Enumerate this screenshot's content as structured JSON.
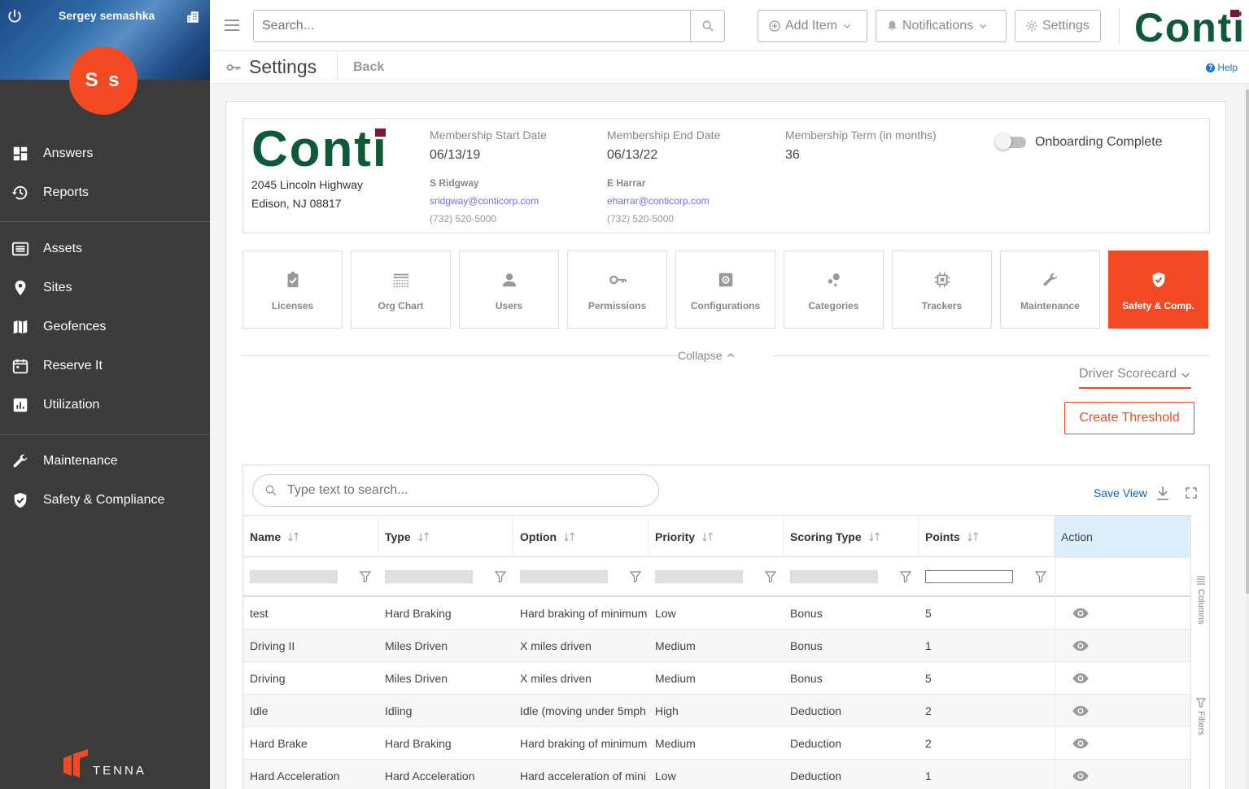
{
  "user": {
    "name": "Sergey semashka",
    "initials": "S s"
  },
  "sidebar": {
    "items": [
      {
        "label": "Answers",
        "icon": "dashboard-icon"
      },
      {
        "label": "Reports",
        "icon": "history-icon"
      },
      {
        "label": "Assets",
        "icon": "list-icon"
      },
      {
        "label": "Sites",
        "icon": "location-pin-icon"
      },
      {
        "label": "Geofences",
        "icon": "map-icon"
      },
      {
        "label": "Reserve It",
        "icon": "calendar-icon"
      },
      {
        "label": "Utilization",
        "icon": "bar-chart-icon"
      },
      {
        "label": "Maintenance",
        "icon": "wrench-icon"
      },
      {
        "label": "Safety & Compliance",
        "icon": "shield-check-icon"
      }
    ],
    "brand": "TENNA"
  },
  "topbar": {
    "search_placeholder": "Search...",
    "add_item": "Add Item",
    "notifications": "Notifications",
    "settings": "Settings",
    "logo": "Conti"
  },
  "header": {
    "title": "Settings",
    "back": "Back",
    "help": "Help"
  },
  "company": {
    "logo": "Conti",
    "address_line1": "2045 Lincoln Highway",
    "address_line2": "Edison, NJ 08817",
    "start_label": "Membership Start Date",
    "start_value": "06/13/19",
    "end_label": "Membership End Date",
    "end_value": "06/13/22",
    "term_label": "Membership Term (in months)",
    "term_value": "36",
    "contact1": {
      "name": "S Ridgway",
      "email": "sridgway@conticorp.com",
      "phone": "(732) 520-5000"
    },
    "contact2": {
      "name": "E Harrar",
      "email": "eharrar@conticorp.com",
      "phone": "(732) 520-5000"
    },
    "onboarding_label": "Onboarding Complete",
    "onboarding_complete": false
  },
  "tiles": [
    {
      "label": "Licenses",
      "icon": "clipboard-check-icon"
    },
    {
      "label": "Org Chart",
      "icon": "org-chart-icon"
    },
    {
      "label": "Users",
      "icon": "user-icon"
    },
    {
      "label": "Permissions",
      "icon": "key-icon"
    },
    {
      "label": "Configurations",
      "icon": "settings-box-icon"
    },
    {
      "label": "Categories",
      "icon": "categories-icon"
    },
    {
      "label": "Trackers",
      "icon": "chip-icon"
    },
    {
      "label": "Maintenance",
      "icon": "wrench-icon"
    },
    {
      "label": "Safety & Comp.",
      "icon": "shield-check-icon",
      "active": true
    }
  ],
  "collapse_label": "Collapse",
  "scorecard_dropdown": "Driver Scorecard",
  "create_threshold": "Create Threshold",
  "grid": {
    "search_placeholder": "Type text to search...",
    "save_view": "Save View",
    "columns": [
      "Name",
      "Type",
      "Option",
      "Priority",
      "Scoring Type",
      "Points",
      "Action"
    ],
    "side_tabs": {
      "columns": "Columns",
      "filters": "Filters"
    },
    "rows": [
      [
        "test",
        "Hard Braking",
        "Hard braking of minimum",
        "Low",
        "Bonus",
        "5"
      ],
      [
        "Driving II",
        "Miles Driven",
        "X miles driven",
        "Medium",
        "Bonus",
        "1"
      ],
      [
        "Driving",
        "Miles Driven",
        "X miles driven",
        "Medium",
        "Bonus",
        "5"
      ],
      [
        "Idle",
        "Idling",
        "Idle (moving under 5mph",
        "High",
        "Deduction",
        "2"
      ],
      [
        "Hard Brake",
        "Hard Braking",
        "Hard braking of minimum",
        "Medium",
        "Deduction",
        "2"
      ],
      [
        "Hard Acceleration",
        "Hard Acceleration",
        "Hard acceleration of mini",
        "Low",
        "Deduction",
        "1"
      ]
    ]
  },
  "colors": {
    "accent": "#f44a24",
    "sidebar_bg": "#3b3b3b",
    "link": "#1565c0",
    "logo_green": "#0e5a38",
    "logo_maroon": "#7a1540"
  }
}
